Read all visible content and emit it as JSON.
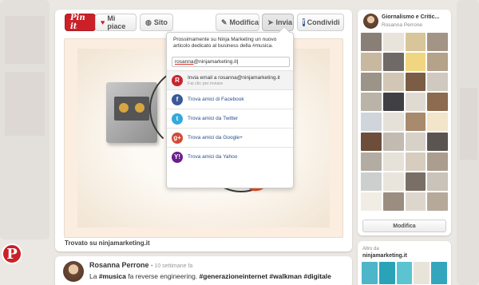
{
  "toolbar": {
    "pinit_label": "Pin it",
    "like_label": "Mi piace",
    "site_label": "Sito",
    "edit_label": "Modifica",
    "send_label": "Invia",
    "share_label": "Condividi"
  },
  "pin": {
    "source_text": "Trovato su ninjamarketing.it"
  },
  "send_dropdown": {
    "message": "Prossimamente su Ninja Marketing un nuovo articolo dedicato al business della #musica.",
    "email_value_prefix": "rosanna",
    "email_value_suffix": "@ninjamarketing.it",
    "items": [
      {
        "icon": "R",
        "label": "Invia email a rosanna@ninjamarketing.it",
        "sub": "Fai clic per inviare",
        "color": "#c8232c"
      },
      {
        "icon": "f",
        "label": "Trova amici di Facebook",
        "color": "#3b5998"
      },
      {
        "icon": "t",
        "label": "Trova amici da Twitter",
        "color": "#33a9dc"
      },
      {
        "icon": "g+",
        "label": "Trova amici da Google+",
        "color": "#d34836"
      },
      {
        "icon": "Y!",
        "label": "Trova amici da Yahoo",
        "color": "#6b1e8e"
      }
    ]
  },
  "board": {
    "title": "Giornalismo e Critic...",
    "owner": "Rosanna Perrone",
    "button_label": "Modifica",
    "thumb_colors": [
      "#8a7f76",
      "#e8e4dc",
      "#d9c59a",
      "#a39586",
      "#c8b8a0",
      "#6f6a66",
      "#f0d680",
      "#b5a28a",
      "#9c9389",
      "#d2c7b5",
      "#7b5d45",
      "#cfc9c0",
      "#b9b3a8",
      "#3f3f44",
      "#e0dbd2",
      "#8c6b4f",
      "#cfd5da",
      "#e5e0d8",
      "#a88a6c",
      "#f2e5c9",
      "#6d4e3a",
      "#c1bbb2",
      "#d7d1c7",
      "#5b5552",
      "#b3aca2",
      "#e6e2da",
      "#d6cdbf",
      "#ab9e8f",
      "#cbd0cf",
      "#e9e5dc",
      "#7a6f66",
      "#c9c3b9",
      "#f1ede5",
      "#9b8e81",
      "#dcd6cc",
      "#b7a99a"
    ]
  },
  "also": {
    "label": "Altro da",
    "site": "ninjamarketing.it",
    "thumb_colors": [
      "#4db6c9",
      "#2aa3b8",
      "#5cc3d0",
      "#e9e4da",
      "#33a6bd"
    ]
  },
  "comment": {
    "author": "Rosanna Perrone",
    "time": "• 10 settimane fa",
    "text_prefix": "La ",
    "tag1": "#musica",
    "text_mid": " fa reverse engineering. ",
    "tags_end": "#generazioneinternet #walkman #digitale"
  },
  "logo_letter": "P"
}
